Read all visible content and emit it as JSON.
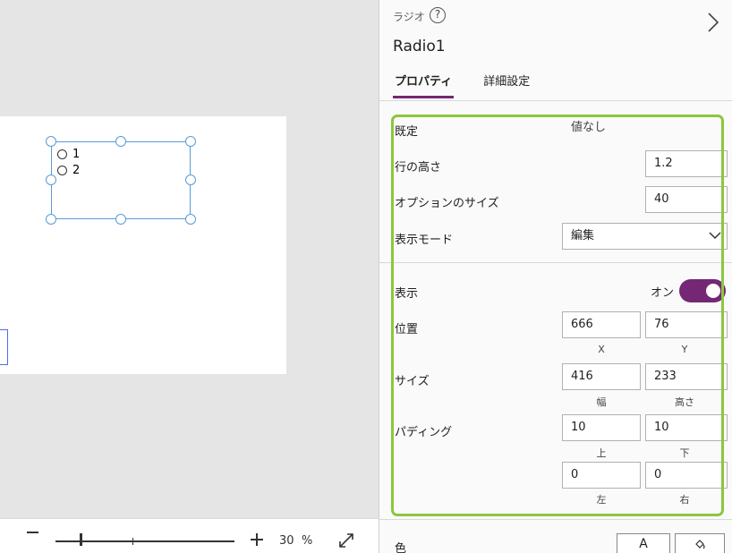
{
  "canvas": {
    "radio_options": [
      "1",
      "2"
    ]
  },
  "zoom": {
    "value": "30",
    "unit": "%",
    "level": 0.14
  },
  "panel": {
    "control_type": "ラジオ",
    "help_icon": "?",
    "control_name": "Radio1",
    "tabs": [
      {
        "label": "プロパティ",
        "active": true
      },
      {
        "label": "詳細設定",
        "active": false
      }
    ],
    "properties": {
      "default": {
        "label": "既定",
        "value": "値なし"
      },
      "line_height": {
        "label": "行の高さ",
        "value": "1.2"
      },
      "option_size": {
        "label": "オプションのサイズ",
        "value": "40"
      },
      "display_mode": {
        "label": "表示モード",
        "value": "編集"
      },
      "visible": {
        "label": "表示",
        "toggle_text": "オン",
        "on": true
      },
      "position": {
        "label": "位置",
        "x": "666",
        "y": "76",
        "x_label": "X",
        "y_label": "Y"
      },
      "size": {
        "label": "サイズ",
        "width": "416",
        "height": "233",
        "width_label": "幅",
        "height_label": "高さ"
      },
      "padding": {
        "label": "パディング",
        "top": "10",
        "bottom": "10",
        "left": "0",
        "right": "0",
        "top_label": "上",
        "bottom_label": "下",
        "left_label": "左",
        "right_label": "右"
      },
      "color": {
        "label": "色",
        "text_button": "A"
      }
    }
  },
  "colors": {
    "accent": "#742774",
    "highlight": "#8cc63f",
    "selection": "#5b9bd5"
  },
  "icons": [
    "help-icon",
    "chevron-right-icon",
    "chevron-down-icon",
    "expand-icon",
    "fill-bucket-icon",
    "zoom-out-icon",
    "zoom-in-icon"
  ]
}
